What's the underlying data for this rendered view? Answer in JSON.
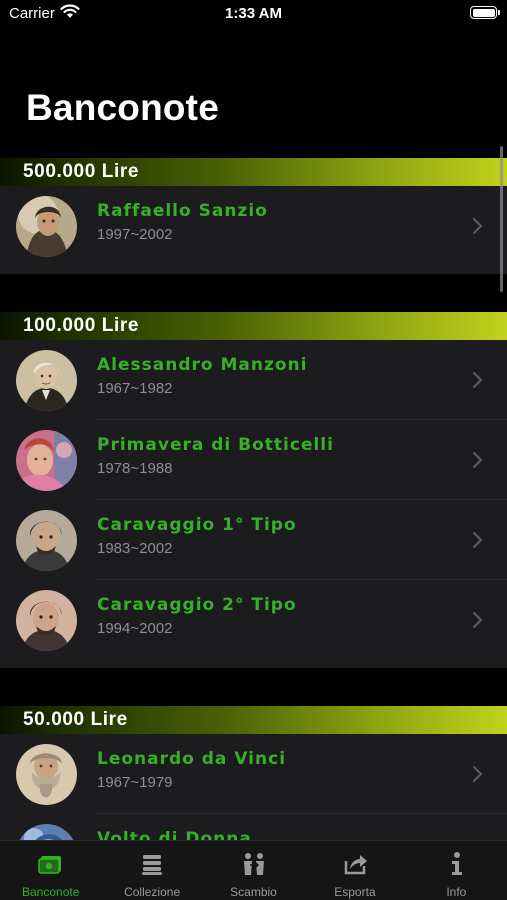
{
  "status_bar": {
    "carrier": "Carrier",
    "time": "1:33 AM"
  },
  "page": {
    "title": "Banconote"
  },
  "sections": [
    {
      "header": "500.000  Lire",
      "items": [
        {
          "title": "Raffaello  Sanzio",
          "years": "1997~2002",
          "icon": "raffaello-portrait"
        }
      ]
    },
    {
      "header": "100.000  Lire",
      "items": [
        {
          "title": "Alessandro  Manzoni",
          "years": "1967~1982",
          "icon": "manzoni-portrait"
        },
        {
          "title": "Primavera  di  Botticelli",
          "years": "1978~1988",
          "icon": "botticelli-portrait"
        },
        {
          "title": "Caravaggio  1°  Tipo",
          "years": "1983~2002",
          "icon": "caravaggio-portrait"
        },
        {
          "title": "Caravaggio  2°  Tipo",
          "years": "1994~2002",
          "icon": "caravaggio-portrait"
        }
      ]
    },
    {
      "header": "50.000  Lire",
      "items": [
        {
          "title": "Leonardo  da  Vinci",
          "years": "1967~1979",
          "icon": "leonardo-portrait"
        },
        {
          "title": "Volto  di  Donna",
          "years": "",
          "icon": "donna-portrait"
        }
      ]
    }
  ],
  "tab_bar": {
    "tabs": [
      {
        "label": "Banconote",
        "icon": "banknote-icon",
        "active": true
      },
      {
        "label": "Collezione",
        "icon": "stack-icon",
        "active": false
      },
      {
        "label": "Scambio",
        "icon": "exchange-icon",
        "active": false
      },
      {
        "label": "Esporta",
        "icon": "share-icon",
        "active": false
      },
      {
        "label": "Info",
        "icon": "info-icon",
        "active": false
      }
    ]
  },
  "colors": {
    "accent": "#35b027",
    "header_start": "#0b1300",
    "header_end": "#c1d21c",
    "cell_bg": "#1c1c1e"
  }
}
